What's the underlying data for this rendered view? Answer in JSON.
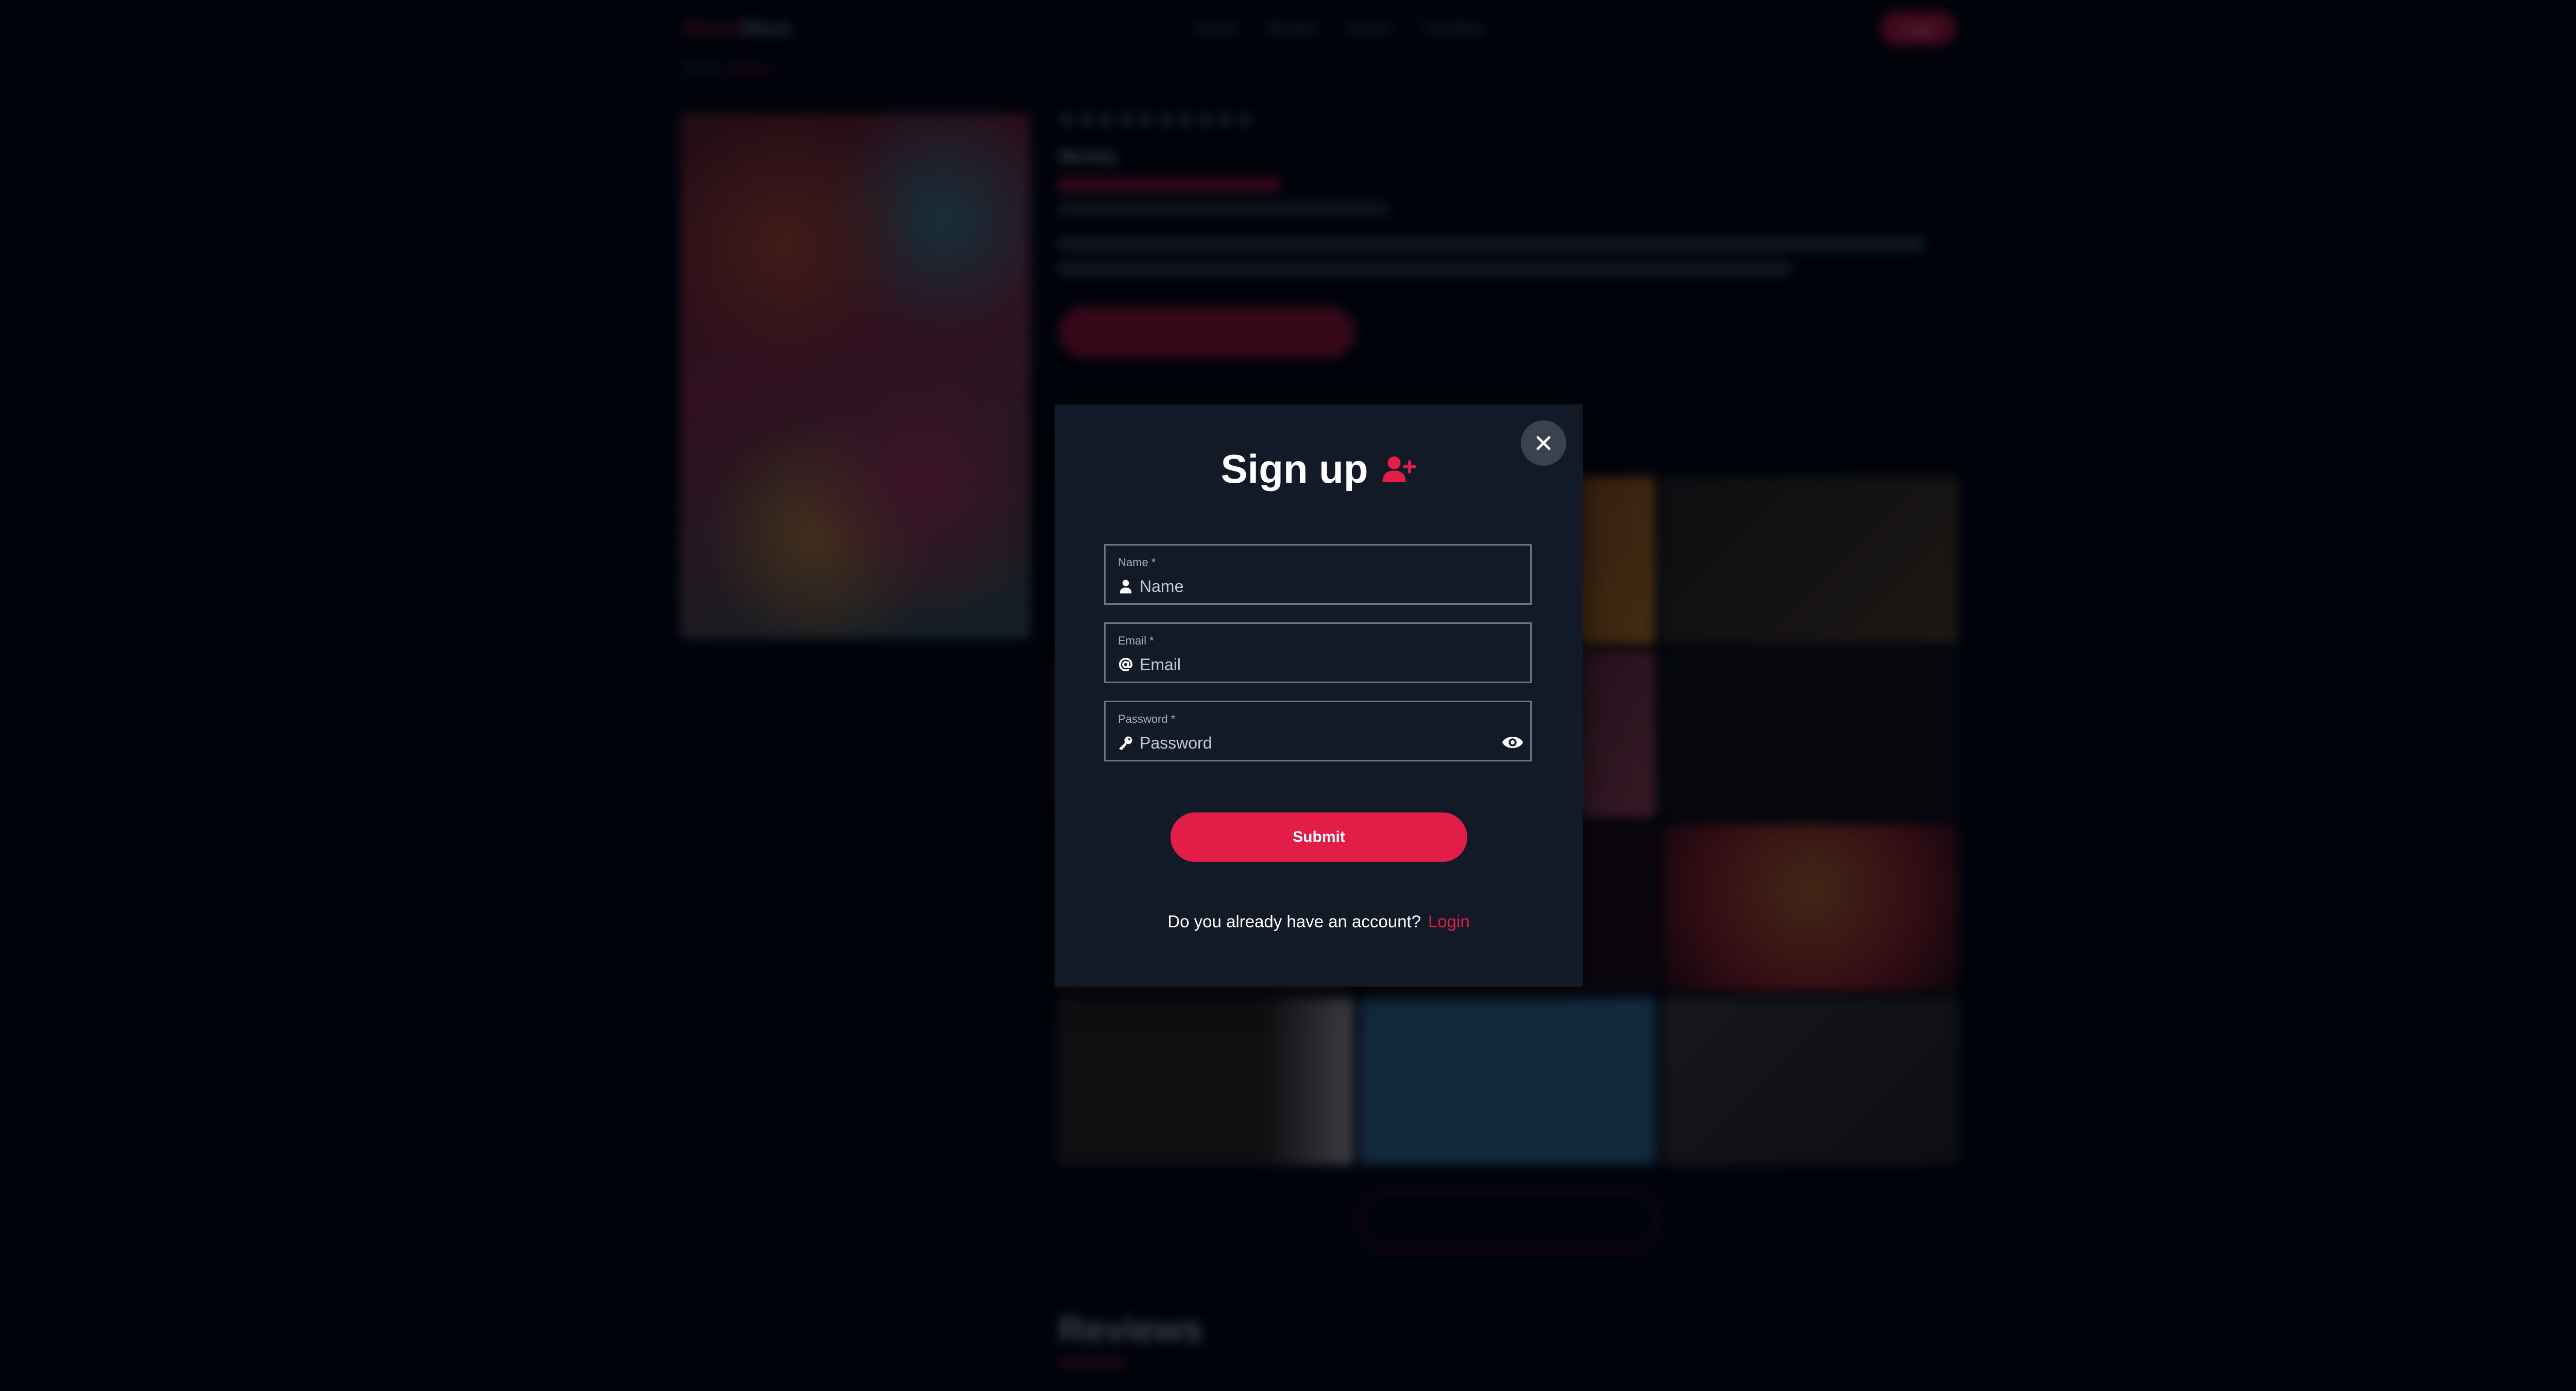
{
  "background": {
    "logo": {
      "primary": "Movie",
      "secondary": "Maze"
    },
    "nav": [
      "Home",
      "Movies",
      "Series",
      "Trending"
    ],
    "login_button": "Login",
    "breadcrumb": {
      "home": "Home",
      "sep1": "/",
      "current": "Wonka"
    },
    "stars": "★★★★★★★★★★",
    "year": "Wonka",
    "reviews_heading": "Reviews"
  },
  "modal": {
    "title": "Sign up",
    "fields": {
      "name": {
        "label": "Name *",
        "placeholder": "Name",
        "value": ""
      },
      "email": {
        "label": "Email *",
        "placeholder": "Email",
        "value": ""
      },
      "password": {
        "label": "Password *",
        "placeholder": "Password",
        "value": ""
      }
    },
    "submit_label": "Submit",
    "account_prompt": "Do you already have an account?",
    "login_link": "Login"
  },
  "icons": {
    "close": "close-icon",
    "add_user": "user-plus-icon",
    "name": "user-icon",
    "email": "at-icon",
    "password": "key-icon",
    "toggle_password": "eye-icon"
  },
  "colors": {
    "accent": "#e11d48",
    "modal_bg": "#121a27",
    "page_bg": "#020612"
  }
}
